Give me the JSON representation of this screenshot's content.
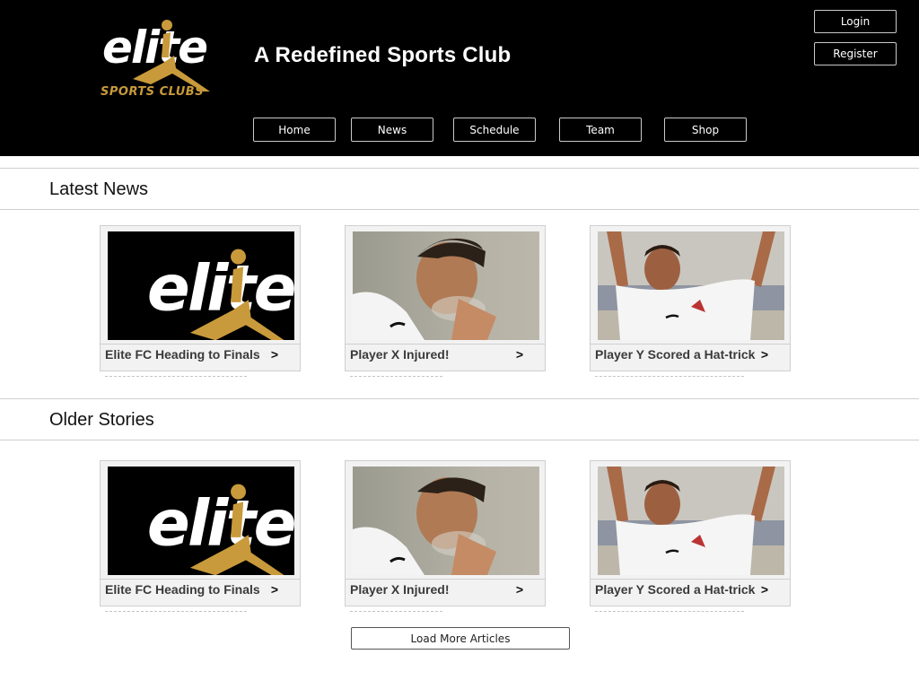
{
  "header": {
    "logo": {
      "word": "elite",
      "sub": "SPORTS CLUBS"
    },
    "site_title": "A Redefined Sports Club",
    "login_label": "Login",
    "register_label": "Register",
    "nav": [
      {
        "label": "Home"
      },
      {
        "label": "News"
      },
      {
        "label": "Schedule"
      },
      {
        "label": "Team"
      },
      {
        "label": "Shop"
      }
    ]
  },
  "latest_news": {
    "title": "Latest News",
    "cards": [
      {
        "caption": "Elite FC Heading to Finals",
        "arrow": ">",
        "image": "elite-logo"
      },
      {
        "caption": "Player X Injured!",
        "arrow": ">",
        "image": "player-x-photo"
      },
      {
        "caption": "Player Y Scored a Hat-trick",
        "arrow": ">",
        "image": "player-y-photo"
      }
    ]
  },
  "older_stories": {
    "title": "Older Stories",
    "cards": [
      {
        "caption": "Elite FC Heading to Finals",
        "arrow": ">",
        "image": "elite-logo"
      },
      {
        "caption": "Player X Injured!",
        "arrow": ">",
        "image": "player-x-photo"
      },
      {
        "caption": "Player Y Scored a Hat-trick",
        "arrow": ">",
        "image": "player-y-photo"
      }
    ]
  },
  "load_more_label": "Load More Articles",
  "colors": {
    "header_bg": "#000000",
    "brand_gold": "#c99a3b",
    "card_bg": "#f2f2f2"
  }
}
